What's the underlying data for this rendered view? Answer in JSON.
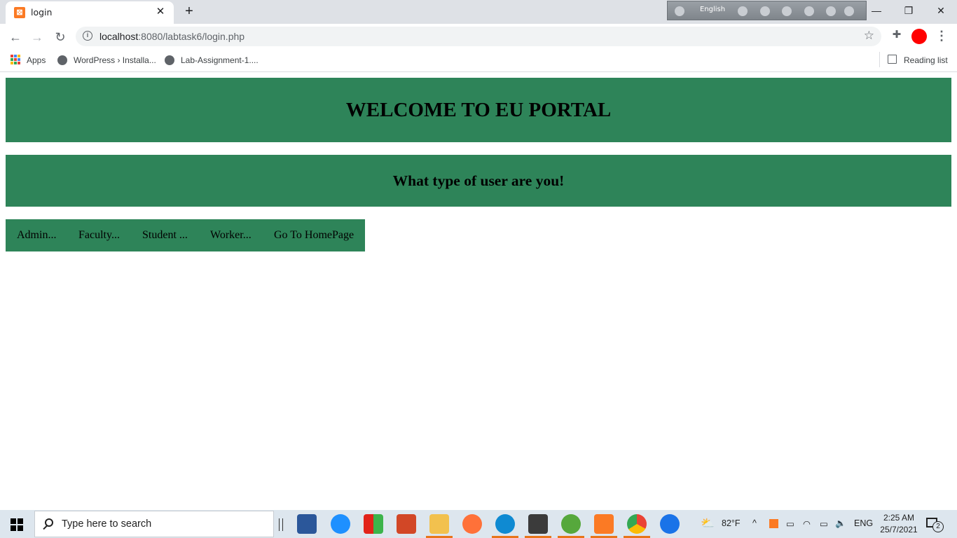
{
  "browser": {
    "tab": {
      "title": "login",
      "favicon": "xampp-icon"
    },
    "url": {
      "host": "localhost",
      "rest": ":8080/labtask6/login.php"
    },
    "bookmarks": [
      {
        "label": "Apps"
      },
      {
        "label": "WordPress › Installa..."
      },
      {
        "label": "Lab-Assignment-1...."
      }
    ],
    "reading_list": "Reading list",
    "ime_language": "English"
  },
  "page": {
    "heading": "WELCOME TO EU PORTAL",
    "subheading": "What type of user are you!",
    "nav": [
      {
        "label": "Admin..."
      },
      {
        "label": "Faculty..."
      },
      {
        "label": "Student ..."
      },
      {
        "label": "Worker..."
      },
      {
        "label": "Go To HomePage"
      }
    ],
    "accent_color": "#2e8459"
  },
  "taskbar": {
    "search_placeholder": "Type here to search",
    "weather": "82°F",
    "language": "ENG",
    "time": "2:25 AM",
    "date": "25/7/2021",
    "notification_count": "2"
  }
}
